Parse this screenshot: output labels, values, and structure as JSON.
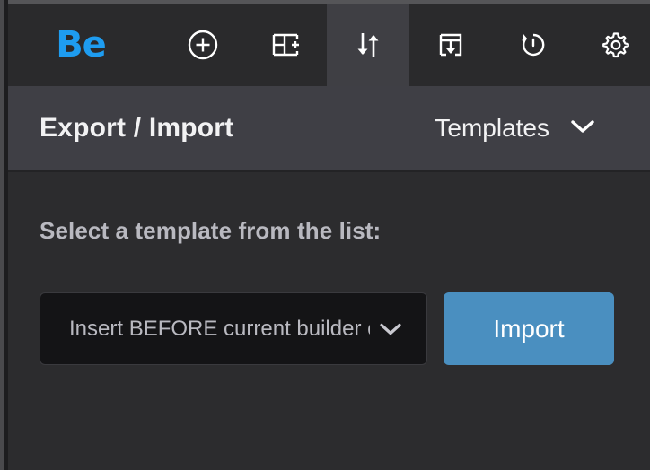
{
  "app": {
    "brand_label": "Be",
    "accent_blue": "#1e9cf0",
    "button_blue": "#4a8fc0",
    "toolbar_bg": "#2a2a2c",
    "active_tab_bg": "#3f3f44",
    "header_bg": "#3f3f45",
    "content_bg": "#2c2c2e"
  },
  "toolbar": {
    "items": [
      {
        "icon": "plus-circle-icon",
        "label": "Add",
        "active": false
      },
      {
        "icon": "layout-add-icon",
        "label": "Add Section",
        "active": false
      },
      {
        "icon": "import-export-arrows-icon",
        "label": "Export / Import",
        "active": true
      },
      {
        "icon": "save-template-icon",
        "label": "Save",
        "active": false
      },
      {
        "icon": "revision-history-icon",
        "label": "History",
        "active": false
      },
      {
        "icon": "gear-icon",
        "label": "Settings",
        "active": false
      }
    ]
  },
  "header": {
    "title": "Export / Import",
    "dropdown_label": "Templates",
    "dropdown_icon": "chevron-down-icon"
  },
  "main": {
    "instruction": "Select a template from the list:",
    "template_select": {
      "value": "Insert BEFORE current builder content",
      "icon": "chevron-down-icon"
    },
    "import_button_label": "Import"
  }
}
